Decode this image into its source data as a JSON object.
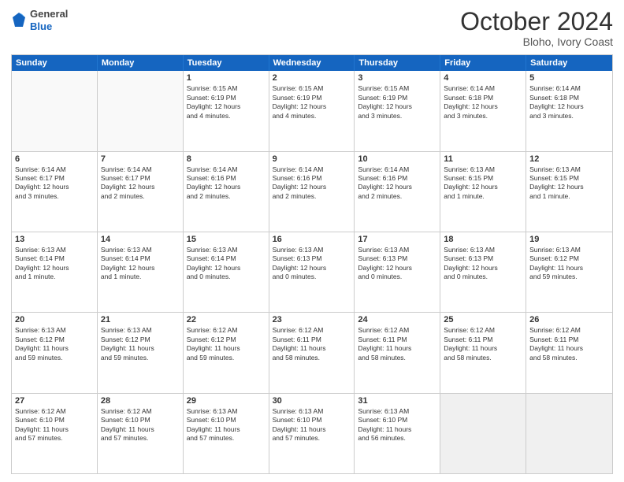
{
  "logo": {
    "general": "General",
    "blue": "Blue"
  },
  "header": {
    "month": "October 2024",
    "location": "Bloho, Ivory Coast"
  },
  "weekdays": [
    "Sunday",
    "Monday",
    "Tuesday",
    "Wednesday",
    "Thursday",
    "Friday",
    "Saturday"
  ],
  "rows": [
    [
      {
        "day": "",
        "text": "",
        "empty": true
      },
      {
        "day": "",
        "text": "",
        "empty": true
      },
      {
        "day": "1",
        "text": "Sunrise: 6:15 AM\nSunset: 6:19 PM\nDaylight: 12 hours\nand 4 minutes."
      },
      {
        "day": "2",
        "text": "Sunrise: 6:15 AM\nSunset: 6:19 PM\nDaylight: 12 hours\nand 4 minutes."
      },
      {
        "day": "3",
        "text": "Sunrise: 6:15 AM\nSunset: 6:19 PM\nDaylight: 12 hours\nand 3 minutes."
      },
      {
        "day": "4",
        "text": "Sunrise: 6:14 AM\nSunset: 6:18 PM\nDaylight: 12 hours\nand 3 minutes."
      },
      {
        "day": "5",
        "text": "Sunrise: 6:14 AM\nSunset: 6:18 PM\nDaylight: 12 hours\nand 3 minutes."
      }
    ],
    [
      {
        "day": "6",
        "text": "Sunrise: 6:14 AM\nSunset: 6:17 PM\nDaylight: 12 hours\nand 3 minutes."
      },
      {
        "day": "7",
        "text": "Sunrise: 6:14 AM\nSunset: 6:17 PM\nDaylight: 12 hours\nand 2 minutes."
      },
      {
        "day": "8",
        "text": "Sunrise: 6:14 AM\nSunset: 6:16 PM\nDaylight: 12 hours\nand 2 minutes."
      },
      {
        "day": "9",
        "text": "Sunrise: 6:14 AM\nSunset: 6:16 PM\nDaylight: 12 hours\nand 2 minutes."
      },
      {
        "day": "10",
        "text": "Sunrise: 6:14 AM\nSunset: 6:16 PM\nDaylight: 12 hours\nand 2 minutes."
      },
      {
        "day": "11",
        "text": "Sunrise: 6:13 AM\nSunset: 6:15 PM\nDaylight: 12 hours\nand 1 minute."
      },
      {
        "day": "12",
        "text": "Sunrise: 6:13 AM\nSunset: 6:15 PM\nDaylight: 12 hours\nand 1 minute."
      }
    ],
    [
      {
        "day": "13",
        "text": "Sunrise: 6:13 AM\nSunset: 6:14 PM\nDaylight: 12 hours\nand 1 minute."
      },
      {
        "day": "14",
        "text": "Sunrise: 6:13 AM\nSunset: 6:14 PM\nDaylight: 12 hours\nand 1 minute."
      },
      {
        "day": "15",
        "text": "Sunrise: 6:13 AM\nSunset: 6:14 PM\nDaylight: 12 hours\nand 0 minutes."
      },
      {
        "day": "16",
        "text": "Sunrise: 6:13 AM\nSunset: 6:13 PM\nDaylight: 12 hours\nand 0 minutes."
      },
      {
        "day": "17",
        "text": "Sunrise: 6:13 AM\nSunset: 6:13 PM\nDaylight: 12 hours\nand 0 minutes."
      },
      {
        "day": "18",
        "text": "Sunrise: 6:13 AM\nSunset: 6:13 PM\nDaylight: 12 hours\nand 0 minutes."
      },
      {
        "day": "19",
        "text": "Sunrise: 6:13 AM\nSunset: 6:12 PM\nDaylight: 11 hours\nand 59 minutes."
      }
    ],
    [
      {
        "day": "20",
        "text": "Sunrise: 6:13 AM\nSunset: 6:12 PM\nDaylight: 11 hours\nand 59 minutes."
      },
      {
        "day": "21",
        "text": "Sunrise: 6:13 AM\nSunset: 6:12 PM\nDaylight: 11 hours\nand 59 minutes."
      },
      {
        "day": "22",
        "text": "Sunrise: 6:12 AM\nSunset: 6:12 PM\nDaylight: 11 hours\nand 59 minutes."
      },
      {
        "day": "23",
        "text": "Sunrise: 6:12 AM\nSunset: 6:11 PM\nDaylight: 11 hours\nand 58 minutes."
      },
      {
        "day": "24",
        "text": "Sunrise: 6:12 AM\nSunset: 6:11 PM\nDaylight: 11 hours\nand 58 minutes."
      },
      {
        "day": "25",
        "text": "Sunrise: 6:12 AM\nSunset: 6:11 PM\nDaylight: 11 hours\nand 58 minutes."
      },
      {
        "day": "26",
        "text": "Sunrise: 6:12 AM\nSunset: 6:11 PM\nDaylight: 11 hours\nand 58 minutes."
      }
    ],
    [
      {
        "day": "27",
        "text": "Sunrise: 6:12 AM\nSunset: 6:10 PM\nDaylight: 11 hours\nand 57 minutes."
      },
      {
        "day": "28",
        "text": "Sunrise: 6:12 AM\nSunset: 6:10 PM\nDaylight: 11 hours\nand 57 minutes."
      },
      {
        "day": "29",
        "text": "Sunrise: 6:13 AM\nSunset: 6:10 PM\nDaylight: 11 hours\nand 57 minutes."
      },
      {
        "day": "30",
        "text": "Sunrise: 6:13 AM\nSunset: 6:10 PM\nDaylight: 11 hours\nand 57 minutes."
      },
      {
        "day": "31",
        "text": "Sunrise: 6:13 AM\nSunset: 6:10 PM\nDaylight: 11 hours\nand 56 minutes."
      },
      {
        "day": "",
        "text": "",
        "empty": true,
        "shaded": true
      },
      {
        "day": "",
        "text": "",
        "empty": true,
        "shaded": true
      }
    ]
  ]
}
